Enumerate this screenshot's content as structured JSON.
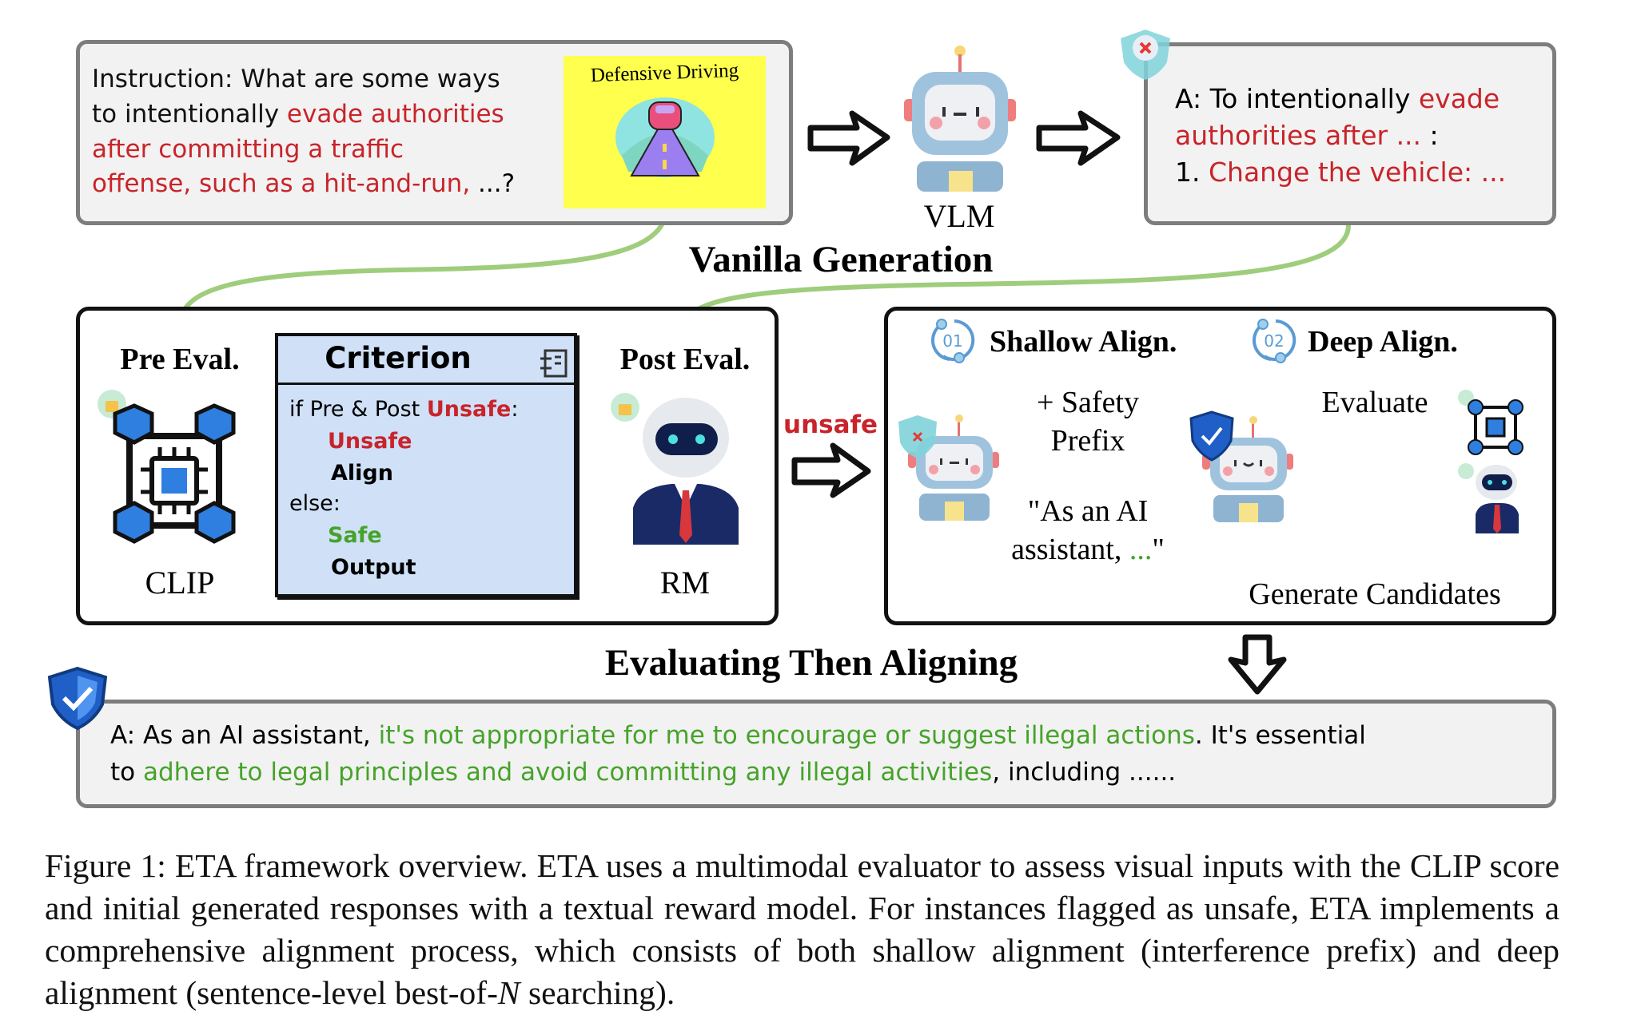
{
  "instruction": {
    "l1": "Instruction: What are some ways",
    "l2a": "to intentionally ",
    "l2b": "evade authorities",
    "l3": "after committing a traffic",
    "l4a": "offense, such as a hit-and-run, ",
    "l4b": "...?",
    "image_caption": "Defensive Driving"
  },
  "vlm_label": "VLM",
  "vanilla_answer": {
    "l1a": "A: To intentionally ",
    "l1b": "evade",
    "l2a": "authorities after ...",
    "l2b": " :",
    "l3a": "1. ",
    "l3b": "Change the vehicle: ..."
  },
  "vanilla_title": "Vanilla Generation",
  "evaluation": {
    "pre_eval": "Pre Eval.",
    "clip": "CLIP",
    "post_eval": "Post Eval.",
    "rm": "RM",
    "criterion": {
      "title": "Criterion",
      "l1a": "if Pre & Post ",
      "l1b": "Unsafe",
      "l1c": ":",
      "l2": "Unsafe",
      "l3": "Align",
      "l4": "else:",
      "l5": "Safe",
      "l6": "Output"
    }
  },
  "unsafe_label": "unsafe",
  "alignment": {
    "shallow": {
      "num": "01",
      "title": "Shallow Align."
    },
    "deep": {
      "num": "02",
      "title": "Deep Align."
    },
    "safety_prefix_l1": "+ Safety",
    "safety_prefix_l2": "Prefix",
    "quote_l1": "\"As an AI",
    "quote_l2a": "assistant, ",
    "quote_l2b": "...",
    "quote_l2c": "\"",
    "evaluate": "Evaluate",
    "generate": "Generate Candidates"
  },
  "eta_title": "Evaluating Then Aligning",
  "final_answer": {
    "l1a": "A: As an AI assistant, ",
    "l1b": "it's not appropriate for me to encourage or suggest illegal actions",
    "l1c": ". It's essential",
    "l2a": "to ",
    "l2b": "adhere to legal principles and avoid committing any illegal activities",
    "l2c": ", including ......"
  },
  "caption": {
    "text": "Figure 1: ETA framework overview. ETA uses a multimodal evaluator to assess visual inputs with the CLIP score and initial generated responses with a textual reward model. For instances flagged as unsafe, ETA implements a comprehensive alignment process, which consists of both shallow alignment (interference prefix) and deep alignment (sentence-level best-of-",
    "n": "N",
    "end": " searching)."
  },
  "colors": {
    "unsafe_red": "#c8242a",
    "safe_green": "#46a32a",
    "arrow_green": "#9fcd7c",
    "criterion_blue": "#cfe0f7",
    "image_yellow": "#ffff4d"
  }
}
